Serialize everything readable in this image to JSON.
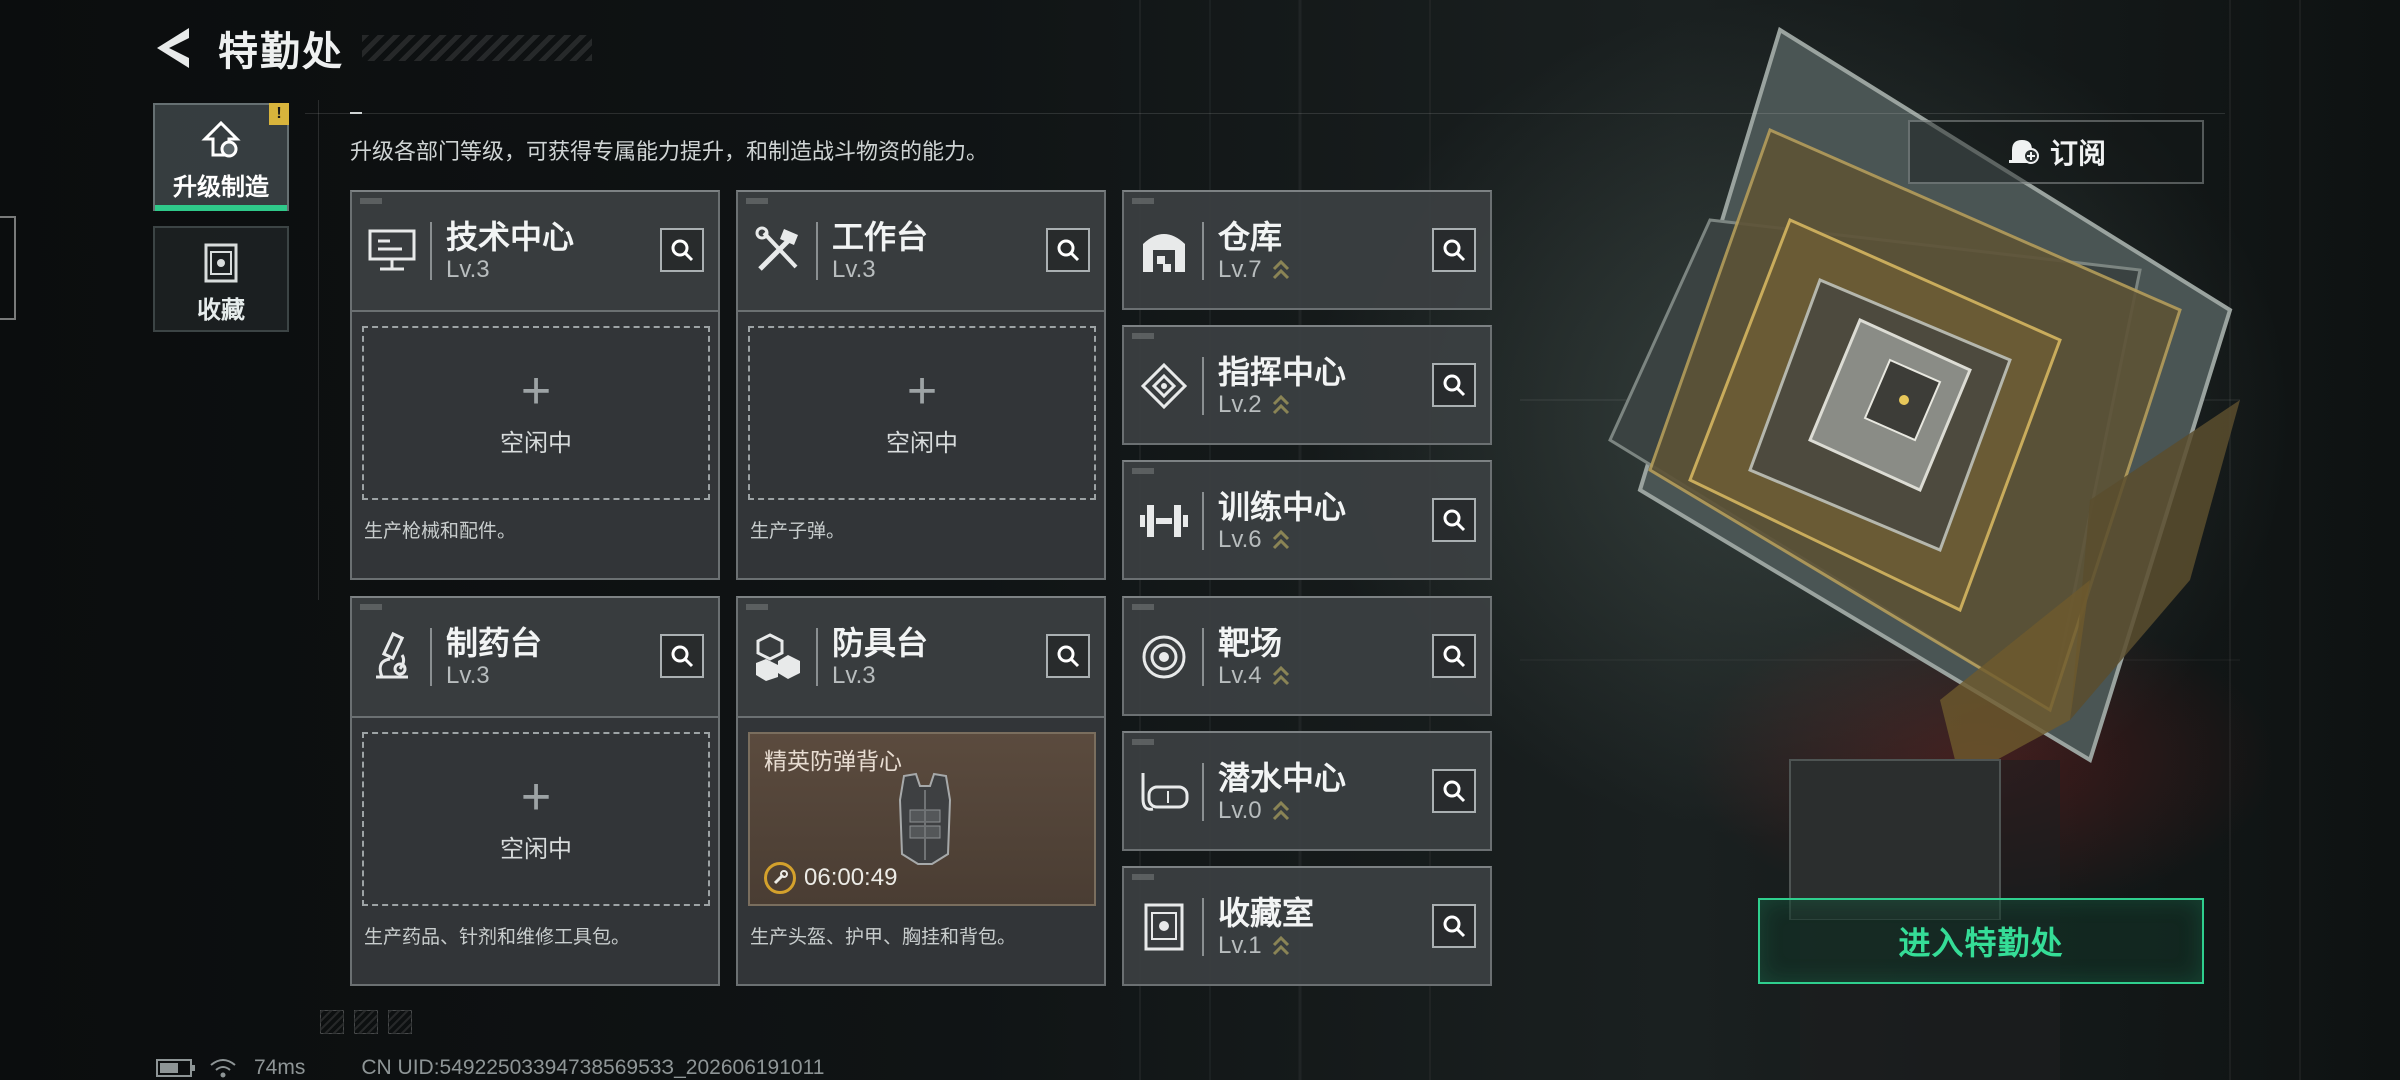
{
  "header": {
    "title": "特勤处"
  },
  "tabs": [
    {
      "label": "升级制造",
      "active": true,
      "icon": "upgrade-icon",
      "alert": "!"
    },
    {
      "label": "收藏",
      "active": false,
      "icon": "collection-icon"
    }
  ],
  "subtitle": "升级各部门等级，可获得专属能力提升，和制造战斗物资的能力。",
  "production": [
    {
      "name": "技术中心",
      "level": "Lv.3",
      "icon": "computer-icon",
      "slot": {
        "state": "idle",
        "label": "空闲中"
      },
      "desc": "生产枪械和配件。"
    },
    {
      "name": "工作台",
      "level": "Lv.3",
      "icon": "tools-icon",
      "slot": {
        "state": "idle",
        "label": "空闲中"
      },
      "desc": "生产子弹。"
    },
    {
      "name": "制药台",
      "level": "Lv.3",
      "icon": "microscope-icon",
      "slot": {
        "state": "idle",
        "label": "空闲中"
      },
      "desc": "生产药品、针剂和维修工具包。"
    },
    {
      "name": "防具台",
      "level": "Lv.3",
      "icon": "blocks-icon",
      "slot": {
        "state": "producing",
        "item": "精英防弹背心",
        "timer": "06:00:49"
      },
      "desc": "生产头盔、护甲、胸挂和背包。"
    }
  ],
  "facilities": [
    {
      "name": "仓库",
      "level": "Lv.7",
      "icon": "warehouse-icon"
    },
    {
      "name": "指挥中心",
      "level": "Lv.2",
      "icon": "command-icon"
    },
    {
      "name": "训练中心",
      "level": "Lv.6",
      "icon": "dumbbell-icon"
    },
    {
      "name": "靶场",
      "level": "Lv.4",
      "icon": "target-icon"
    },
    {
      "name": "潜水中心",
      "level": "Lv.0",
      "icon": "diving-mask-icon"
    },
    {
      "name": "收藏室",
      "level": "Lv.1",
      "icon": "collection-room-icon"
    }
  ],
  "subscribe_label": "订阅",
  "enter_label": "进入特勤处",
  "status": {
    "ping": "74ms",
    "uid": "CN UID:5492250339473856953З_202606191011"
  },
  "colors": {
    "accent_green": "#2fcf8e",
    "timer_gold": "#d4a12c",
    "level_chevron": "#8a8455",
    "alert_yellow": "#d8b43c"
  }
}
